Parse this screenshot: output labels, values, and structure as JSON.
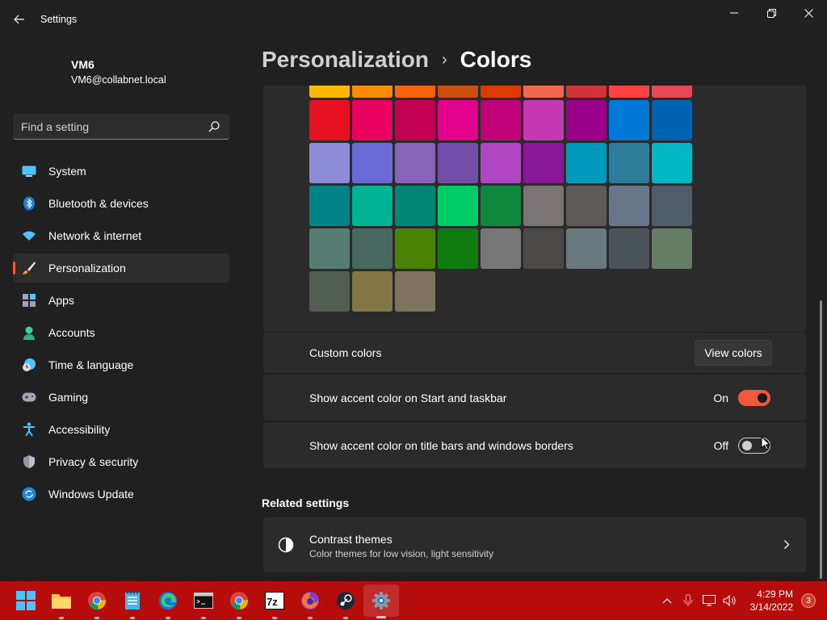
{
  "window": {
    "title": "Settings"
  },
  "user": {
    "name": "VM6",
    "email": "VM6@collabnet.local"
  },
  "search": {
    "placeholder": "Find a setting"
  },
  "sidebar": {
    "items": [
      {
        "label": "System",
        "icon": "system-icon"
      },
      {
        "label": "Bluetooth & devices",
        "icon": "bluetooth-icon"
      },
      {
        "label": "Network & internet",
        "icon": "wifi-icon"
      },
      {
        "label": "Personalization",
        "icon": "brush-icon",
        "active": true
      },
      {
        "label": "Apps",
        "icon": "apps-icon"
      },
      {
        "label": "Accounts",
        "icon": "person-icon"
      },
      {
        "label": "Time & language",
        "icon": "clock-globe-icon"
      },
      {
        "label": "Gaming",
        "icon": "gamepad-icon"
      },
      {
        "label": "Accessibility",
        "icon": "accessibility-icon"
      },
      {
        "label": "Privacy & security",
        "icon": "shield-icon"
      },
      {
        "label": "Windows Update",
        "icon": "update-icon"
      }
    ]
  },
  "breadcrumb": {
    "parent": "Personalization",
    "separator": "›",
    "current": "Colors"
  },
  "accent_colors": [
    "#ffb900",
    "#f78c08",
    "#f7630c",
    "#ca5010",
    "#da3b01",
    "#ef6950",
    "#d13438",
    "#ff4343",
    "#e74856",
    "#e81123",
    "#ea005e",
    "#c30052",
    "#e3008c",
    "#bf0077",
    "#c239b3",
    "#9a0089",
    "#0078d7",
    "#0063b1",
    "#8e8cd8",
    "#6b69d6",
    "#8764b8",
    "#744da9",
    "#b146c2",
    "#881798",
    "#0099bc",
    "#2d7d9a",
    "#00b7c3",
    "#038387",
    "#00b294",
    "#018574",
    "#00cc6a",
    "#10893e",
    "#7a7574",
    "#5d5a58",
    "#68768a",
    "#515c6b",
    "#567c73",
    "#486860",
    "#498205",
    "#107c10",
    "#767676",
    "#4c4a48",
    "#69797e",
    "#4a5459",
    "#647c64",
    "#525e54",
    "#847545",
    "#7e735f"
  ],
  "custom_colors": {
    "label": "Custom colors",
    "button": "View colors"
  },
  "accent_start_taskbar": {
    "label": "Show accent color on Start and taskbar",
    "state": "On",
    "on": true
  },
  "accent_title_bars": {
    "label": "Show accent color on title bars and windows borders",
    "state": "Off",
    "on": false
  },
  "related": {
    "title": "Related settings",
    "contrast": {
      "title": "Contrast themes",
      "subtitle": "Color themes for low vision, light sensitivity"
    }
  },
  "taskbar": {
    "apps": [
      "start-icon",
      "file-explorer-icon",
      "chrome-icon",
      "notepad-icon",
      "edge-icon",
      "terminal-icon",
      "chrome-icon",
      "7zip-icon",
      "firefox-icon",
      "steam-icon",
      "settings-icon"
    ],
    "accent": "#b70c0c",
    "time": "4:29 PM",
    "date": "3/14/2022",
    "notifications": "3"
  },
  "colors": {
    "accent": "#ef5a3a",
    "background": "#202020",
    "card": "#2b2b2b"
  }
}
